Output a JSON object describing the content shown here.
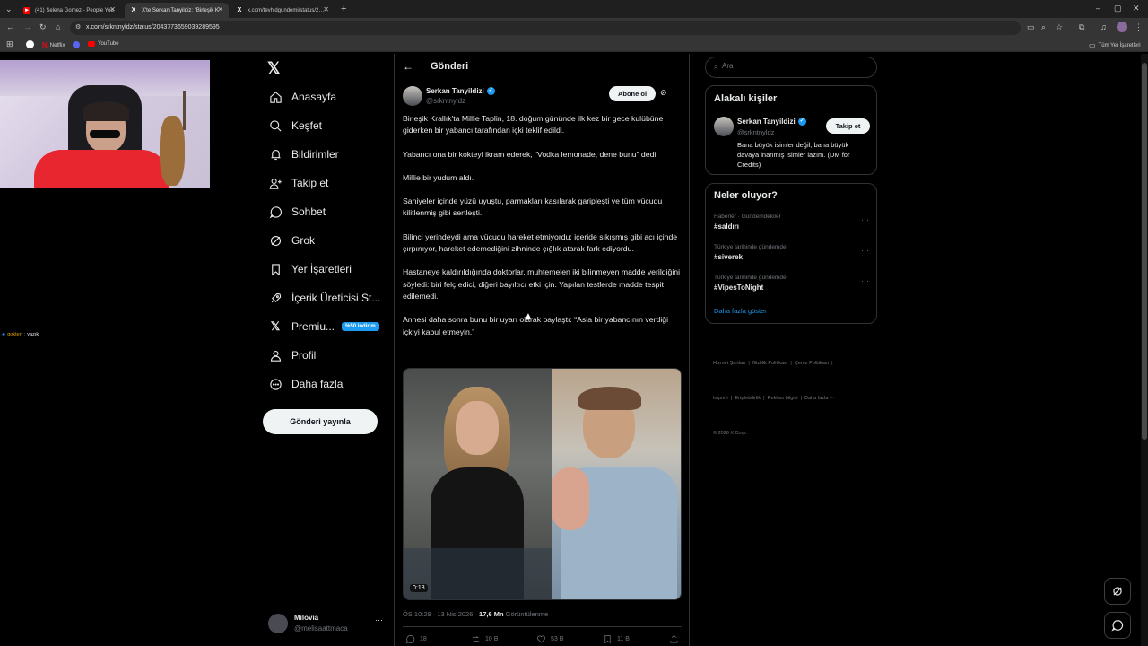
{
  "browser": {
    "tabs": [
      {
        "title": "(41) Selena Gomez - People You",
        "favicon": "youtube-icon",
        "active": false
      },
      {
        "title": "X'te Serkan Tanyildiz: \"Birleşik K",
        "favicon": "x-logo-icon",
        "active": true
      },
      {
        "title": "x.com/tevhidgundemi/status/2…",
        "favicon": "x-logo-icon",
        "active": false
      }
    ],
    "url": "x.com/srkntnyldz/status/2043773659039289595",
    "bookmarks": [
      {
        "label": "Netflix",
        "icon": "netflix-icon"
      },
      {
        "label": "YouTube",
        "icon": "youtube-icon"
      }
    ],
    "all_bookmarks_label": "Tüm Yer İşaretleri"
  },
  "stream_overlay": {
    "chat_user": "gokten",
    "chat_text": "yazık"
  },
  "sidebar": {
    "items": [
      {
        "label": "Anasayfa",
        "icon": "home-icon"
      },
      {
        "label": "Keşfet",
        "icon": "search-icon"
      },
      {
        "label": "Bildirimler",
        "icon": "bell-icon"
      },
      {
        "label": "Takip et",
        "icon": "follow-icon"
      },
      {
        "label": "Sohbet",
        "icon": "chat-icon"
      },
      {
        "label": "Grok",
        "icon": "grok-icon"
      },
      {
        "label": "Yer İşaretleri",
        "icon": "bookmark-icon"
      },
      {
        "label": "İçerik Üreticisi St...",
        "icon": "rocket-icon"
      },
      {
        "label": "Premiu...",
        "icon": "x-premium-icon",
        "badge": "%50 indirim"
      },
      {
        "label": "Profil",
        "icon": "profile-icon"
      },
      {
        "label": "Daha fazla",
        "icon": "more-icon"
      }
    ],
    "post_button": "Gönderi yayınla",
    "account": {
      "name": "Milovia",
      "handle": "@melisaattmaca"
    }
  },
  "main": {
    "header_title": "Gönderi",
    "author": {
      "name": "Serkan Tanyildizi",
      "handle": "@srkntnyldz",
      "verified": true
    },
    "subscribe_label": "Abone ol",
    "paragraphs": [
      "Birleşik Krallık'ta Millie Taplin, 18. doğum gününde ilk kez bir gece kulübüne giderken bir yabancı tarafından içki teklif edildi.",
      "Yabancı ona bir kokteyl ikram ederek, “Vodka lemonade, dene bunu” dedi.",
      "Millie bir yudum aldı.",
      "Saniyeler içinde yüzü uyuştu, parmakları kasılarak garipleşti ve tüm vücudu kilitlenmiş gibi sertleşti.",
      "Bilinci yerindeydi ama vücudu hareket etmiyordu; içeride sıkışmış gibi acı içinde çırpınıyor, hareket edemediğini zihninde çığlık atarak fark ediyordu.",
      "Hastaneye kaldırıldığında doktorlar, muhtemelen iki bilinmeyen madde verildiğini söyledi: biri felç edici, diğeri bayıltıcı etki için. Yapılan testlerde madde tespit edilemedi.",
      "Annesi daha sonra bunu bir uyarı olarak paylaştı: “Asla bir yabancının verdiği içkiyi kabul etmeyin.”"
    ],
    "video_duration": "0:13",
    "timestamp": "ÖS 10:29 · 13 Nis 2026 · ",
    "views_count": "17,6 Mn",
    "views_label": "Görüntülenme",
    "actions": {
      "replies": "18",
      "reposts": "10 B",
      "likes": "53 B",
      "bookmarks": "11 B"
    }
  },
  "right": {
    "search_placeholder": "Ara",
    "related_title": "Alakalı kişiler",
    "related_person": {
      "name": "Serkan Tanyildizi",
      "handle": "@srkntnyldz",
      "bio": "Bana büyük isimler değil, bana büyük davaya inanmış isimler lazım. (DM for Credits)",
      "follow_label": "Takip et"
    },
    "trends_title": "Neler oluyor?",
    "trends": [
      {
        "meta": "Haberler · Gündemdekiler",
        "tag": "#saldırı"
      },
      {
        "meta": "Türkiye tarihinde gündemde",
        "tag": "#siverek"
      },
      {
        "meta": "Türkiye tarihinde gündemde",
        "tag": "#VipesToNight"
      }
    ],
    "show_more": "Daha fazla göster",
    "footer_line1": "Hizmet Şartları  |  Gizlilik Politikası  |  Çerez Politikası  |",
    "footer_line2": "Imprint  |  Erişilebilirlik  |  Reklam bilgisi  |  Daha fazla ···",
    "copyright": "© 2026 X Corp."
  },
  "colors": {
    "accent": "#1d9bf0",
    "background": "#000000",
    "border": "#2f3336",
    "muted": "#71767b"
  }
}
